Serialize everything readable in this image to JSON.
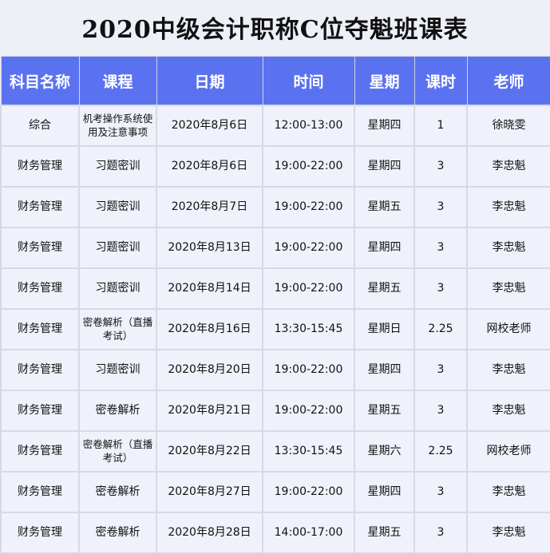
{
  "title": "2020中级会计职称C位夺魁班课表",
  "headers": [
    "科目名称",
    "课程",
    "日期",
    "时间",
    "星期",
    "课时",
    "老师"
  ],
  "rows": [
    [
      "综合",
      "机考操作系统使用及注意事项",
      "2020年8月6日",
      "12:00-13:00",
      "星期四",
      "1",
      "徐晓雯"
    ],
    [
      "财务管理",
      "习题密训",
      "2020年8月6日",
      "19:00-22:00",
      "星期四",
      "3",
      "李忠魁"
    ],
    [
      "财务管理",
      "习题密训",
      "2020年8月7日",
      "19:00-22:00",
      "星期五",
      "3",
      "李忠魁"
    ],
    [
      "财务管理",
      "习题密训",
      "2020年8月13日",
      "19:00-22:00",
      "星期四",
      "3",
      "李忠魁"
    ],
    [
      "财务管理",
      "习题密训",
      "2020年8月14日",
      "19:00-22:00",
      "星期五",
      "3",
      "李忠魁"
    ],
    [
      "财务管理",
      "密卷解析（直播考试）",
      "2020年8月16日",
      "13:30-15:45",
      "星期日",
      "2.25",
      "网校老师"
    ],
    [
      "财务管理",
      "习题密训",
      "2020年8月20日",
      "19:00-22:00",
      "星期四",
      "3",
      "李忠魁"
    ],
    [
      "财务管理",
      "密卷解析",
      "2020年8月21日",
      "19:00-22:00",
      "星期五",
      "3",
      "李忠魁"
    ],
    [
      "财务管理",
      "密卷解析（直播考试）",
      "2020年8月22日",
      "13:30-15:45",
      "星期六",
      "2.25",
      "网校老师"
    ],
    [
      "财务管理",
      "密卷解析",
      "2020年8月27日",
      "19:00-22:00",
      "星期四",
      "3",
      "李忠魁"
    ],
    [
      "财务管理",
      "密卷解析",
      "2020年8月28日",
      "14:00-17:00",
      "星期五",
      "3",
      "李忠魁"
    ]
  ]
}
